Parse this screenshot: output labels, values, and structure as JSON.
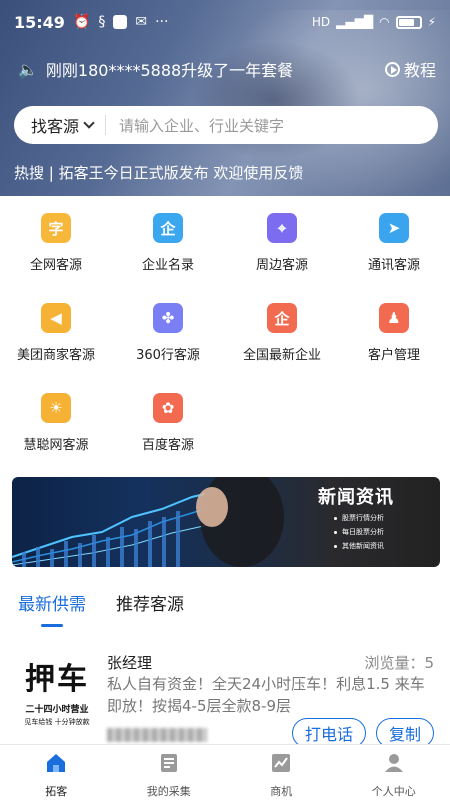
{
  "status": {
    "time": "15:49",
    "network": "HD"
  },
  "notice": {
    "text": "刚刚180****5888升级了一年套餐",
    "tutorial": "教程"
  },
  "search": {
    "type_label": "找客源",
    "placeholder": "请输入企业、行业关键字"
  },
  "hot": {
    "text": "热搜 | 拓客王今日正式版发布 欢迎使用反馈"
  },
  "grid": [
    {
      "label": "全网客源",
      "glyph": "字",
      "color": "#f7b73b",
      "icon": "text-icon"
    },
    {
      "label": "企业名录",
      "glyph": "企",
      "color": "#3ba7ef",
      "icon": "enterprise-icon"
    },
    {
      "label": "周边客源",
      "glyph": "⌖",
      "color": "#7b6cf0",
      "icon": "location-pin-icon"
    },
    {
      "label": "通讯客源",
      "glyph": "➤",
      "color": "#3aa4ef",
      "icon": "send-icon"
    },
    {
      "label": "美团商家客源",
      "glyph": "◀",
      "color": "#f5b234",
      "icon": "tag-icon"
    },
    {
      "label": "360行客源",
      "glyph": "✤",
      "color": "#7a7ff3",
      "icon": "grid-petals-icon"
    },
    {
      "label": "全国最新企业",
      "glyph": "企",
      "color": "#f26a50",
      "icon": "new-enterprise-icon"
    },
    {
      "label": "客户管理",
      "glyph": "♟",
      "color": "#f26a50",
      "icon": "customers-icon"
    },
    {
      "label": "慧聪网客源",
      "glyph": "☀",
      "color": "#f5b234",
      "icon": "hc-icon"
    },
    {
      "label": "百度客源",
      "glyph": "✿",
      "color": "#f26a50",
      "icon": "baidu-paw-icon"
    }
  ],
  "news_banner": {
    "title": "新闻资讯",
    "items": [
      "股票行情分析",
      "每日股票分析",
      "其他新闻资讯"
    ]
  },
  "tabs": {
    "latest": "最新供需",
    "recommended": "推荐客源"
  },
  "listing": {
    "logo_title": "押车",
    "logo_line1": "二十四小时营业",
    "logo_line2": "见车给钱 十分钟放款",
    "seller": "张经理",
    "views": "浏览量：5",
    "description": "私人自有资金！全天24小时压车！利息1.5 来车即放！按揭4-5层全款8-9层",
    "call_button": "打电话",
    "copy_button": "复制"
  },
  "nav": [
    {
      "label": "拓客",
      "icon": "home-icon"
    },
    {
      "label": "我的采集",
      "icon": "document-list-icon"
    },
    {
      "label": "商机",
      "icon": "chart-icon"
    },
    {
      "label": "个人中心",
      "icon": "user-icon"
    }
  ]
}
